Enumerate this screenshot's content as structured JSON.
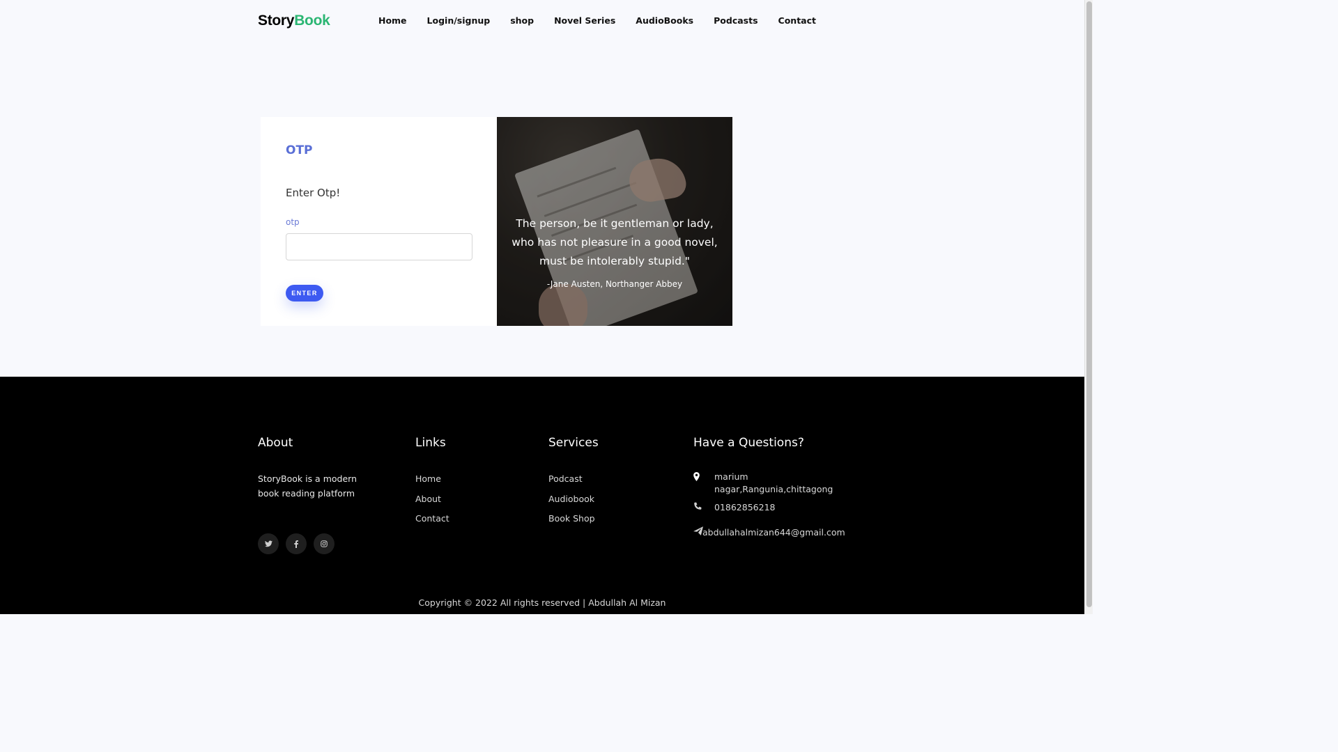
{
  "brand": {
    "part1": "Story",
    "part2": "Book"
  },
  "nav": {
    "items": [
      {
        "label": "Home"
      },
      {
        "label": "Login/signup"
      },
      {
        "label": "shop"
      },
      {
        "label": "Novel Series"
      },
      {
        "label": "AudioBooks"
      },
      {
        "label": "Podcasts"
      },
      {
        "label": "Contact"
      }
    ]
  },
  "otp_form": {
    "title": "OTP",
    "subtitle": "Enter Otp!",
    "field_label": "otp",
    "field_value": "",
    "button_label": "ENTER"
  },
  "quote_panel": {
    "quote": "The person, be it gentleman or lady, who has not pleasure in a good novel, must be intolerably stupid.\"",
    "author": "-Jane Austen, Northanger Abbey"
  },
  "footer": {
    "about": {
      "heading": "About",
      "text": "StoryBook is a modern book reading platform",
      "social": [
        "twitter-icon",
        "facebook-icon",
        "instagram-icon"
      ]
    },
    "links": {
      "heading": "Links",
      "items": [
        "Home",
        "About",
        "Contact"
      ]
    },
    "services": {
      "heading": "Services",
      "items": [
        "Podcast",
        "Audiobook",
        "Book Shop"
      ]
    },
    "questions": {
      "heading": "Have a Questions?",
      "address": "marium nagar,Rangunia,chittagong",
      "phone": "01862856218",
      "email": "abdullahalmizan644@gmail.com"
    },
    "copyright": "Copyright © 2022 All rights reserved | Abdullah Al Mizan"
  },
  "colors": {
    "brand_accent": "#2bb673",
    "otp_title": "#5a6fd6",
    "button": "#3d5af1",
    "footer_bg": "#000000"
  }
}
